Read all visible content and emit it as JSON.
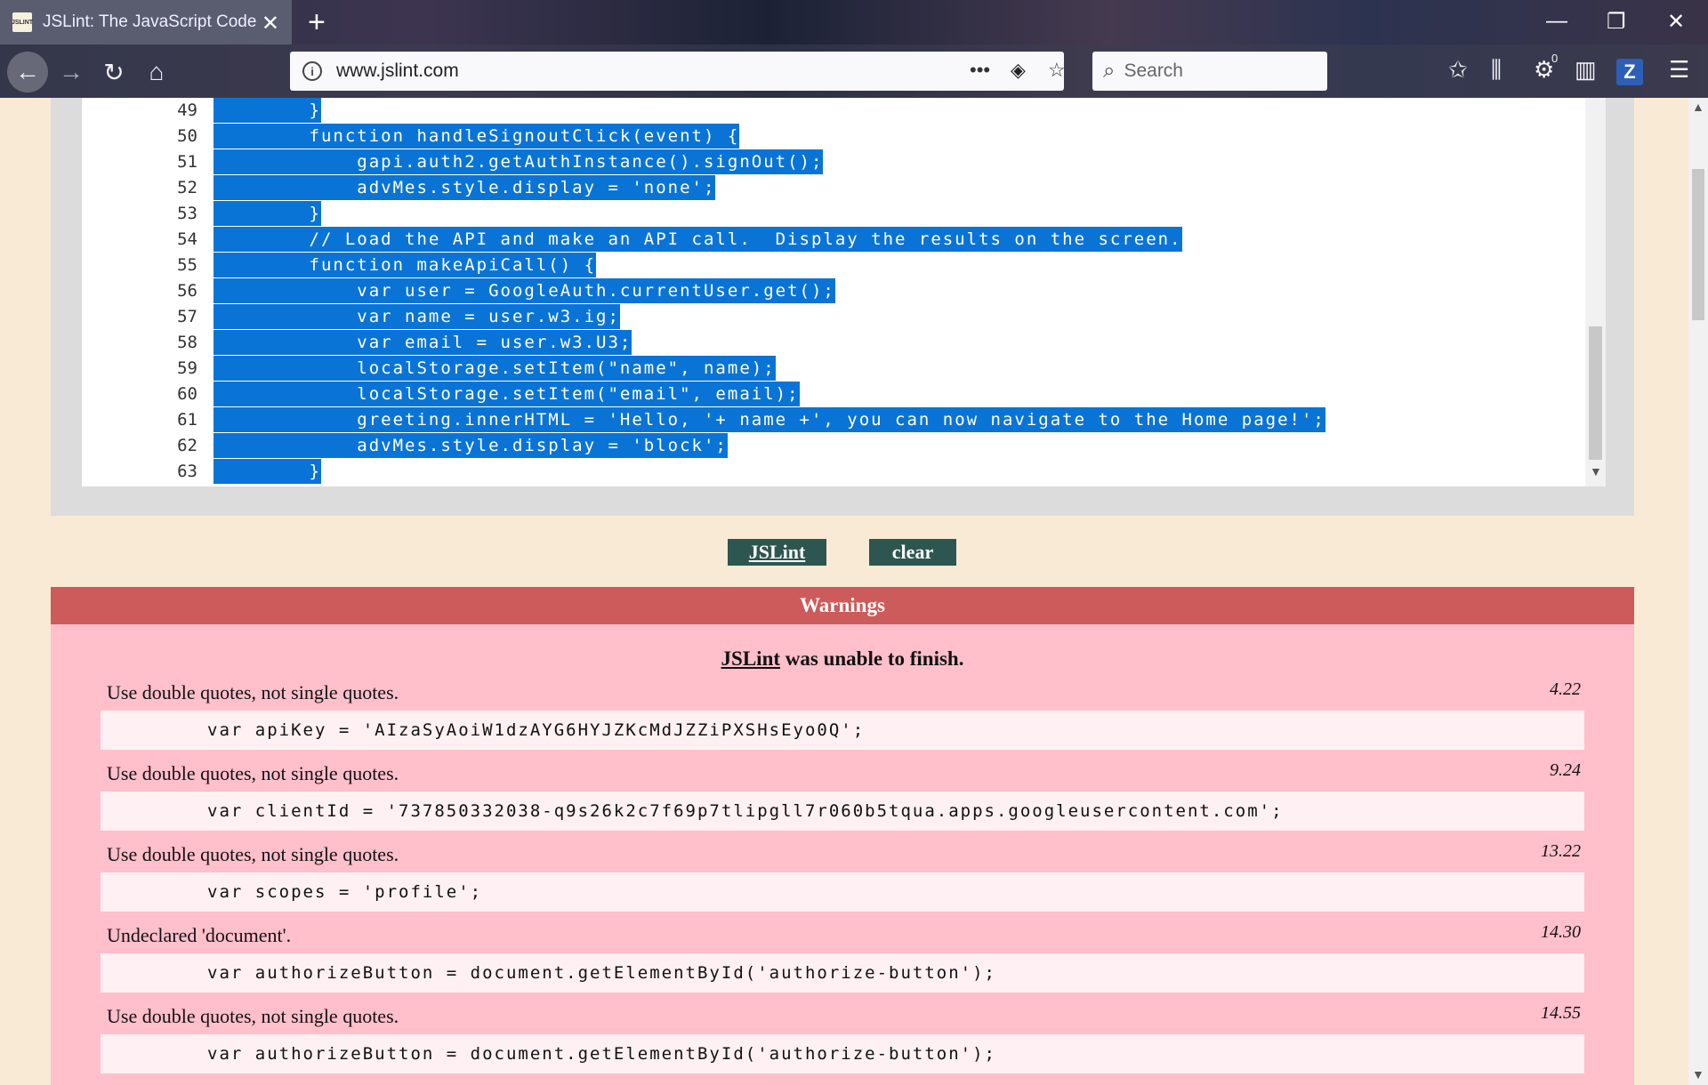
{
  "browser": {
    "tab_title": "JSLint: The JavaScript Code Qu",
    "favicon_text": "JSLINT",
    "url": "www.jslint.com",
    "search_placeholder": "Search",
    "notification_count": "0",
    "profile_letter": "Z"
  },
  "editor": {
    "lines": [
      {
        "num": "49",
        "code": "        }"
      },
      {
        "num": "50",
        "code": "        function handleSignoutClick(event) {"
      },
      {
        "num": "51",
        "code": "            gapi.auth2.getAuthInstance().signOut();"
      },
      {
        "num": "52",
        "code": "            advMes.style.display = 'none';"
      },
      {
        "num": "53",
        "code": "        }"
      },
      {
        "num": "54",
        "code": "        // Load the API and make an API call.  Display the results on the screen."
      },
      {
        "num": "55",
        "code": "        function makeApiCall() {"
      },
      {
        "num": "56",
        "code": "            var user = GoogleAuth.currentUser.get();"
      },
      {
        "num": "57",
        "code": "            var name = user.w3.ig;"
      },
      {
        "num": "58",
        "code": "            var email = user.w3.U3;"
      },
      {
        "num": "59",
        "code": "            localStorage.setItem(\"name\", name);"
      },
      {
        "num": "60",
        "code": "            localStorage.setItem(\"email\", email);"
      },
      {
        "num": "61",
        "code": "            greeting.innerHTML = 'Hello, '+ name +', you can now navigate to the Home page!';"
      },
      {
        "num": "62",
        "code": "            advMes.style.display = 'block';"
      },
      {
        "num": "63",
        "code": "        }"
      }
    ]
  },
  "buttons": {
    "jslint": "JSLint",
    "clear": "clear"
  },
  "warnings": {
    "title": "Warnings",
    "status_link": "JSLint",
    "status_rest": " was unable to finish.",
    "items": [
      {
        "message": "Use double quotes, not single quotes.",
        "location": "4.22",
        "code": "var apiKey = 'AIzaSyAoiW1dzAYG6HYJZKcMdJZZiPXSHsEyo0Q';"
      },
      {
        "message": "Use double quotes, not single quotes.",
        "location": "9.24",
        "code": "var clientId = '737850332038-q9s26k2c7f69p7tlipgll7r060b5tqua.apps.googleusercontent.com';"
      },
      {
        "message": "Use double quotes, not single quotes.",
        "location": "13.22",
        "code": "var scopes = 'profile';"
      },
      {
        "message": "Undeclared 'document'.",
        "location": "14.30",
        "code": "var authorizeButton = document.getElementById('authorize-button');"
      },
      {
        "message": "Use double quotes, not single quotes.",
        "location": "14.55",
        "code": "var authorizeButton = document.getElementById('authorize-button');"
      }
    ]
  },
  "colors": {
    "selection": "#0a74d6",
    "warnings_header": "#cd5b5b",
    "warnings_bg": "#ffbfcb",
    "button_bg": "#2e5650",
    "page_bg": "#f8ead5"
  }
}
